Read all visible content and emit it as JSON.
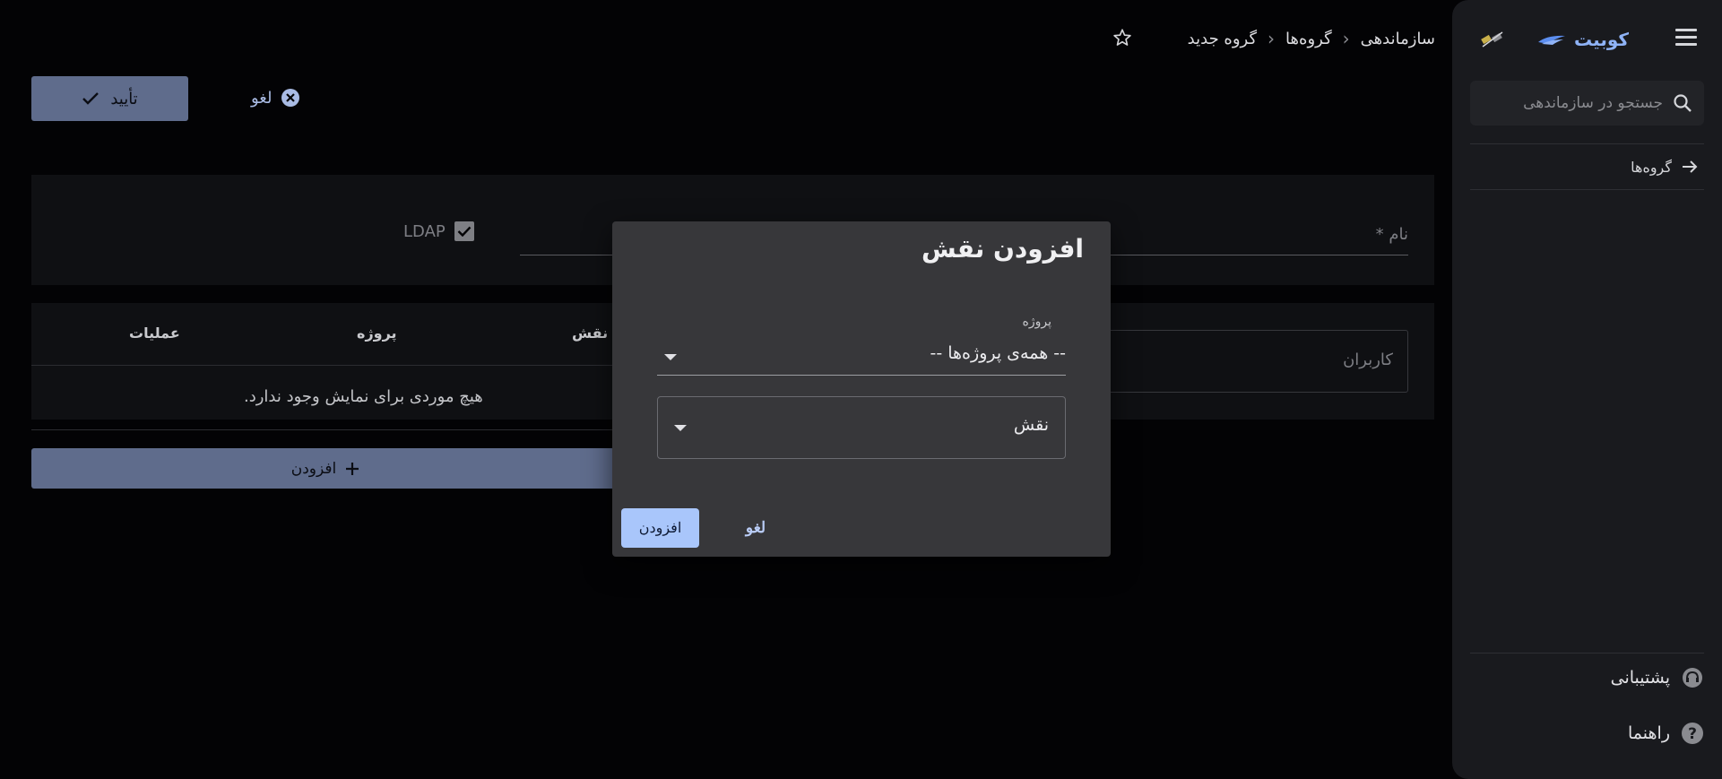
{
  "sidebar": {
    "brand": "کوبیت",
    "search_placeholder": "جستجو در سازماندهی",
    "nav_item": "گروه‌ها",
    "support": "پشتیبانی",
    "help": "راهنما"
  },
  "breadcrumb": {
    "root": "سازماندهی",
    "groups": "گروه‌ها",
    "current": "گروه جدید"
  },
  "toolbar": {
    "confirm": "تأیید",
    "cancel": "لغو"
  },
  "form": {
    "name_label": "نام *",
    "ldap_label": "LDAP",
    "ldap_checked": true,
    "users_tab": "کاربران"
  },
  "table": {
    "headers": [
      "عملیات",
      "پروژه",
      "نقش"
    ],
    "empty_message": "هیچ موردی برای نمایش وجود ندارد.",
    "add_button": "افزودن"
  },
  "dialog": {
    "title": "افزودن نقش",
    "project_label": "پروژه",
    "project_value": "-- همه‌ی پروژه‌ها --",
    "role_placeholder": "نقش",
    "add_button": "افزودن",
    "cancel_button": "لغو"
  },
  "colors": {
    "primary_button": "#5f6c8c",
    "dialog_bg": "#37373a",
    "accent": "#a9c6fb"
  }
}
